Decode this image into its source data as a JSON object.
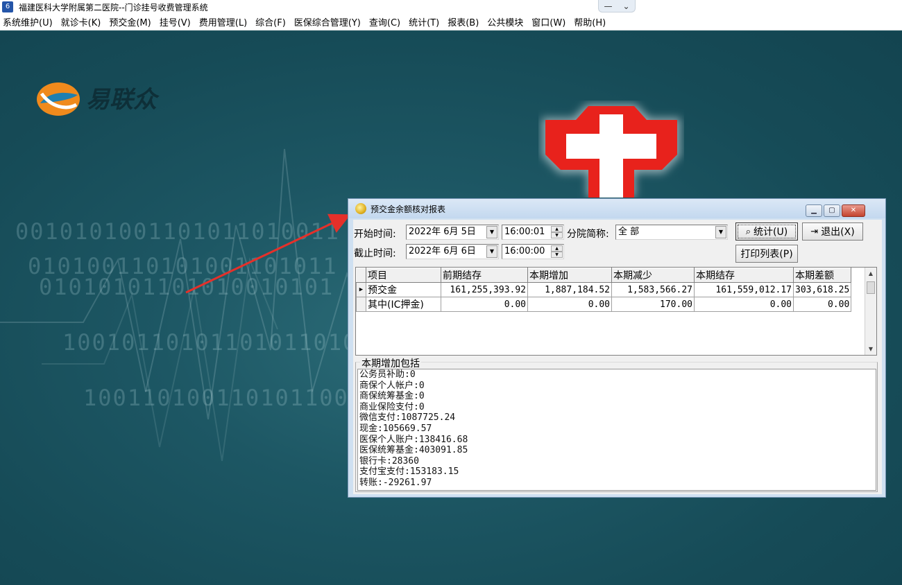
{
  "app": {
    "title": "福建医科大学附属第二医院--门诊挂号收费管理系统",
    "icon_text": "6",
    "winctl_min": "—",
    "winctl_chevron": "⌄"
  },
  "menu": [
    "系统维护(U)",
    "就诊卡(K)",
    "预交金(M)",
    "挂号(V)",
    "费用管理(L)",
    "综合(F)",
    "医保综合管理(Y)",
    "查询(C)",
    "统计(T)",
    "报表(B)",
    "公共模块",
    "窗口(W)",
    "帮助(H)"
  ],
  "logo": {
    "text": "易联众"
  },
  "dialog": {
    "title": "预交金余额核对报表",
    "start_label": "开始时间:",
    "start_date": "2022年 6月 5日",
    "start_time": "16:00:01",
    "end_label": "截止时间:",
    "end_date": "2022年 6月 6日",
    "end_time": "16:00:00",
    "branch_label": "分院简称:",
    "branch_value": "全 部",
    "stats_button": "统计(U)",
    "exit_button": "退出(X)",
    "print_button": "打印列表(P)",
    "grid": {
      "headers": [
        "项目",
        "前期结存",
        "本期增加",
        "本期减少",
        "本期结存",
        "本期差额"
      ],
      "rows": [
        [
          "预交金",
          "161,255,393.92",
          "1,887,184.52",
          "1,583,566.27",
          "161,559,012.17",
          "303,618.25"
        ],
        [
          "其中(IC押金)",
          "0.00",
          "0.00",
          "170.00",
          "0.00",
          "0.00"
        ]
      ]
    },
    "summary": {
      "legend": "本期增加包括",
      "lines": [
        "公务员补助:0",
        "商保个人帐户:0",
        "商保统筹基金:0",
        "商业保险支付:0",
        "微信支付:1087725.24",
        "现金:105669.57",
        "医保个人账户:138416.68",
        "医保统筹基金:403091.85",
        "银行卡:28360",
        "支付宝支付:153183.15",
        "转账:-29261.97"
      ]
    }
  }
}
